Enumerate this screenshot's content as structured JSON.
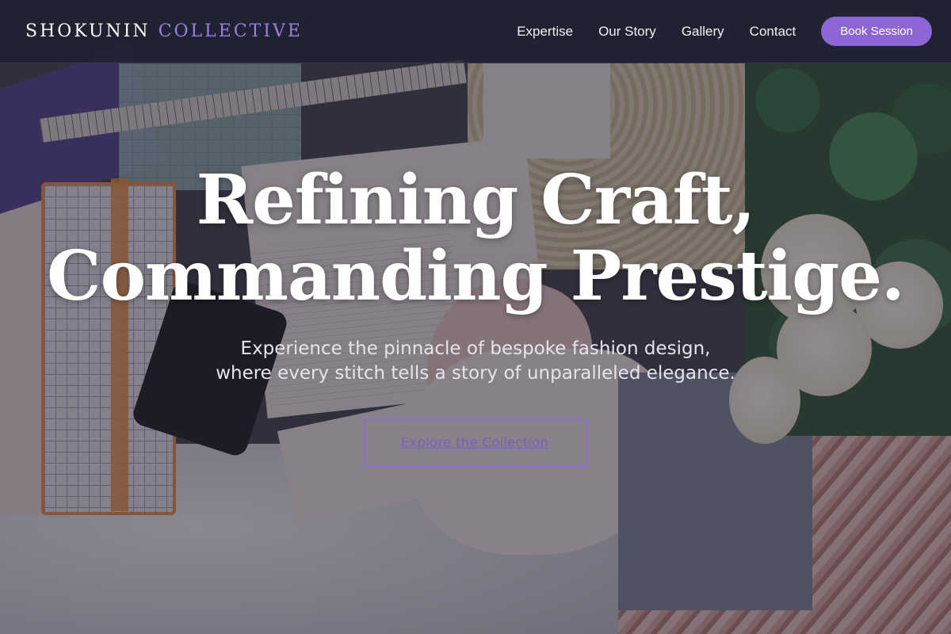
{
  "brand": {
    "name": "SHOKUNIN",
    "accent": "COLLECTIVE"
  },
  "nav": {
    "links": [
      "Expertise",
      "Our Story",
      "Gallery",
      "Contact"
    ],
    "cta": "Book Session"
  },
  "hero": {
    "headline_line1": "Refining Craft,",
    "headline_line2": "Commanding Prestige.",
    "subtitle_line1": "Experience the pinnacle of bespoke fashion design,",
    "subtitle_line2": "where every stitch tells a story of unparalleled elegance.",
    "button": "Explore the Collection"
  },
  "colors": {
    "accent": "#8b66d4",
    "brand_accent": "#a07ce0",
    "nav_background": "#1c202d"
  }
}
